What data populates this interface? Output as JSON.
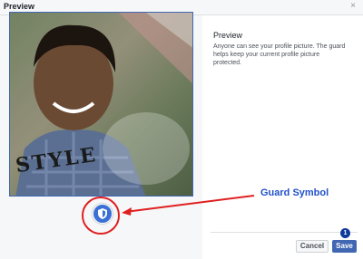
{
  "header": {
    "title": "Preview",
    "close_glyph": "×"
  },
  "preview": {
    "title": "Preview",
    "description": "Anyone can see your profile picture. The guard helps keep your current profile picture protected."
  },
  "annotation": {
    "label": "Guard Symbol",
    "step_number": "1",
    "colors": {
      "circle": "#e02020",
      "arrow": "#e02020",
      "label": "#2151c9"
    }
  },
  "photo": {
    "watermark_text": "STYLE"
  },
  "buttons": {
    "cancel": "Cancel",
    "save": "Save"
  },
  "colors": {
    "accent": "#4267b2",
    "guard": "#3b6fd6"
  },
  "icons": {
    "close": "close-icon",
    "guard": "shield-icon"
  }
}
